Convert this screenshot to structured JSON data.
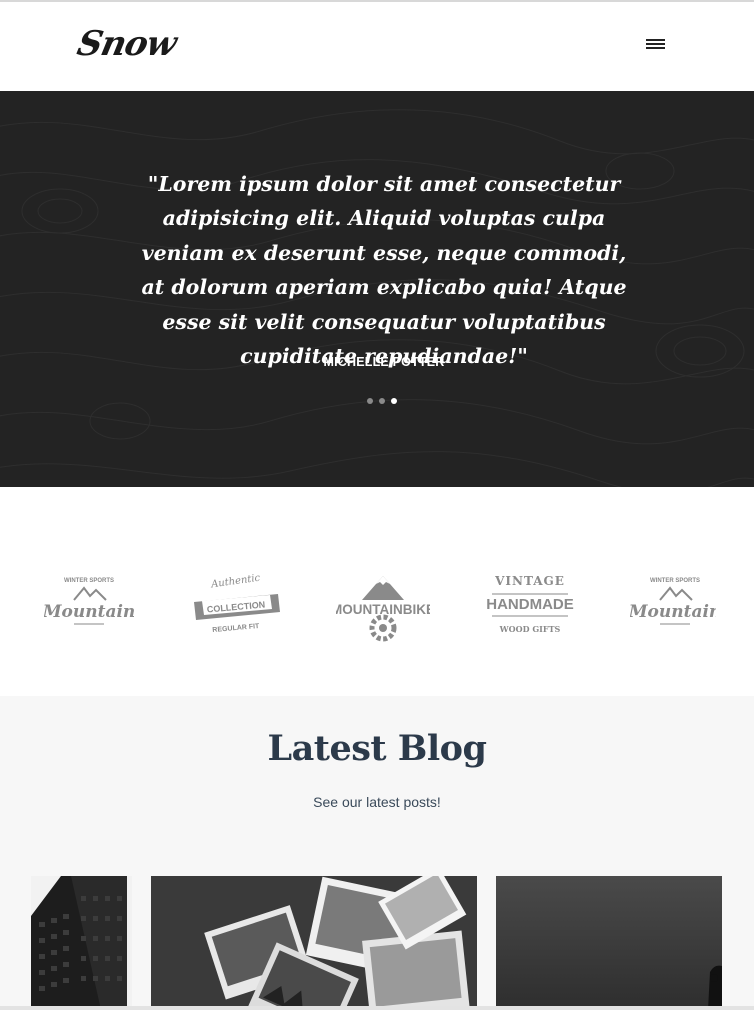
{
  "header": {
    "logo_text": "Snow",
    "menu_icon": "hamburger-menu-icon"
  },
  "testimonial": {
    "quote": "\"Lorem ipsum dolor sit amet consectetur adipisicing elit. Aliquid voluptas culpa veniam ex deserunt esse, neque commodi, at dolorum aperiam explicabo quia! Atque esse sit velit consequatur voluptatibus cupiditate repudiandae!\"",
    "author": "MICHELLE POTTER",
    "slides": 3,
    "active_slide": 3
  },
  "brands": [
    {
      "name": "mountain-badge",
      "top": "WINTER SPORTS",
      "main": "Mountain"
    },
    {
      "name": "collection-badge",
      "top": "Authentic",
      "main": "COLLECTION",
      "bottom": "REGULAR FIT"
    },
    {
      "name": "mountainbike-badge",
      "main": "MOUNTAINBIKE"
    },
    {
      "name": "handmade-badge",
      "top": "VINTAGE",
      "main": "HANDMADE",
      "bottom": "WOOD GIFTS"
    },
    {
      "name": "mountain-badge-repeat",
      "top": "WINTER SPORTS",
      "main": "Mountain"
    }
  ],
  "blog": {
    "title": "Latest Blog",
    "subtitle": "See our latest posts!",
    "posts": [
      {
        "image": "building-facade-photo"
      },
      {
        "image": "scattered-photographs-photo"
      },
      {
        "image": "dark-sky-photo"
      }
    ]
  },
  "colors": {
    "hero_bg": "#232323",
    "heading": "#2c3a4a",
    "badge_gray": "#8a8a8a",
    "blog_bg": "#f7f7f7"
  }
}
